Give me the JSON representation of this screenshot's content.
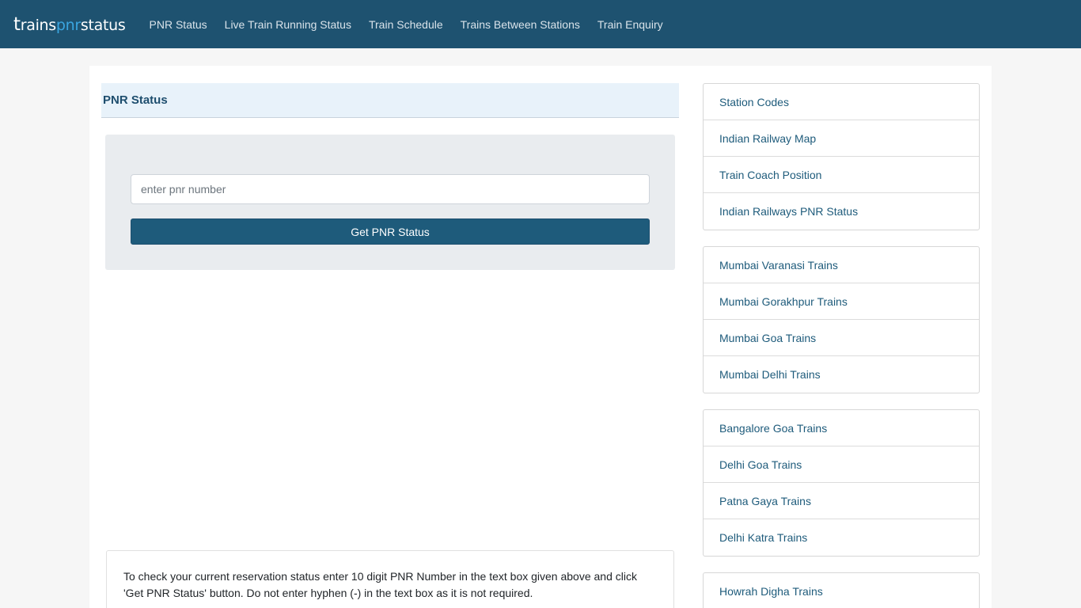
{
  "brand": {
    "part1_big": "t",
    "part1_rest": "rains",
    "part2": "pnr",
    "part3": "status"
  },
  "nav": {
    "items": [
      {
        "label": "PNR Status"
      },
      {
        "label": "Live Train Running Status"
      },
      {
        "label": "Train Schedule"
      },
      {
        "label": "Trains Between Stations"
      },
      {
        "label": "Train Enquiry"
      }
    ]
  },
  "main": {
    "title": "PNR Status",
    "input_placeholder": "enter pnr number",
    "input_value": "",
    "button_label": "Get PNR Status",
    "info_text": "To check your current reservation status enter 10 digit PNR Number in the text box given above and click 'Get PNR Status' button. Do not enter hyphen (-) in the text box as it is not required."
  },
  "sidebar": {
    "groups": [
      {
        "items": [
          {
            "label": "Station Codes"
          },
          {
            "label": "Indian Railway Map"
          },
          {
            "label": "Train Coach Position"
          },
          {
            "label": "Indian Railways PNR Status"
          }
        ]
      },
      {
        "items": [
          {
            "label": "Mumbai Varanasi Trains"
          },
          {
            "label": "Mumbai Gorakhpur Trains"
          },
          {
            "label": "Mumbai Goa Trains"
          },
          {
            "label": "Mumbai Delhi Trains"
          }
        ]
      },
      {
        "items": [
          {
            "label": "Bangalore Goa Trains"
          },
          {
            "label": "Delhi Goa Trains"
          },
          {
            "label": "Patna Gaya Trains"
          },
          {
            "label": "Delhi Katra Trains"
          }
        ]
      },
      {
        "items": [
          {
            "label": "Howrah Digha Trains"
          }
        ]
      }
    ]
  },
  "colors": {
    "navbar": "#1e5270",
    "accent": "#1e5b7b",
    "brand_highlight": "#3aa5e0"
  }
}
